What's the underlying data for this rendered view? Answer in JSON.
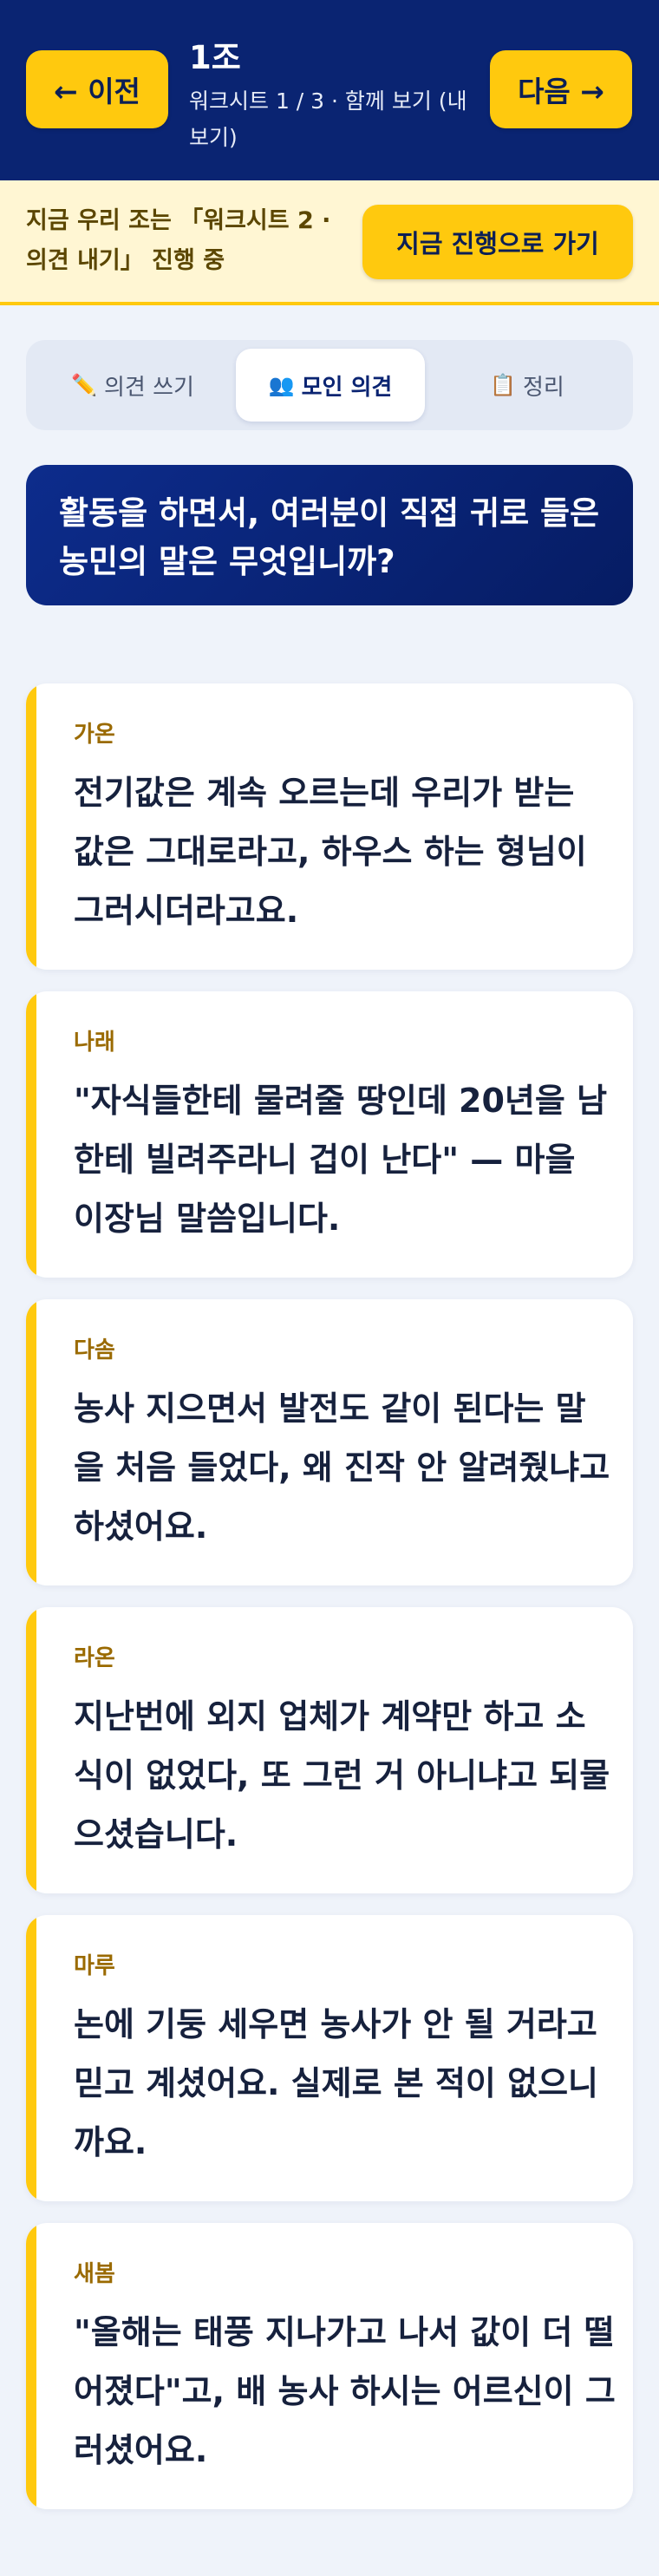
{
  "header": {
    "prev_label": "← 이전",
    "next_label": "다음 →",
    "group": "1조",
    "subtitle": "워크시트 1 / 3 · 함께 보기 (내 보기)"
  },
  "banner": {
    "text": "지금 우리 조는 「워크시트 2 · 의견 내기」 진행 중",
    "button_label": "지금 진행으로 가기"
  },
  "tabs": [
    {
      "icon": "✏️",
      "label": "의견 쓰기"
    },
    {
      "icon": "👥",
      "label": "모인 의견"
    },
    {
      "icon": "📋",
      "label": "정리"
    }
  ],
  "question": "활동을 하면서, 여러분이 직접 귀로 들은 농민의 말은 무엇입니까?",
  "opinions": [
    {
      "name": "가온",
      "text": "전기값은 계속 오르는데 우리가 받는 값은 그대로라고, 하우스 하는 형님이 그러시더라고요."
    },
    {
      "name": "나래",
      "text": "\"자식들한테 물려줄 땅인데 20년을 남한테 빌려주라니 겁이 난다\" — 마을 이장님 말씀입니다."
    },
    {
      "name": "다솜",
      "text": "농사 지으면서 발전도 같이 된다는 말을 처음 들었다, 왜 진작 안 알려줬냐고 하셨어요."
    },
    {
      "name": "라온",
      "text": "지난번에 외지 업체가 계약만 하고 소식이 없었다, 또 그런 거 아니냐고 되물으셨습니다."
    },
    {
      "name": "마루",
      "text": "논에 기둥 세우면 농사가 안 될 거라고 믿고 계셨어요. 실제로 본 적이 없으니까요."
    },
    {
      "name": "새봄",
      "text": "\"올해는 태풍 지나가고 나서 값이 더 떨어졌다\"고, 배 농사 하시는 어르신이 그러셨어요."
    }
  ],
  "colors": {
    "header_bg": "#0a2472",
    "accent_yellow": "#ffc90e",
    "banner_bg": "#fff6d3",
    "page_bg": "#eff3fa"
  }
}
